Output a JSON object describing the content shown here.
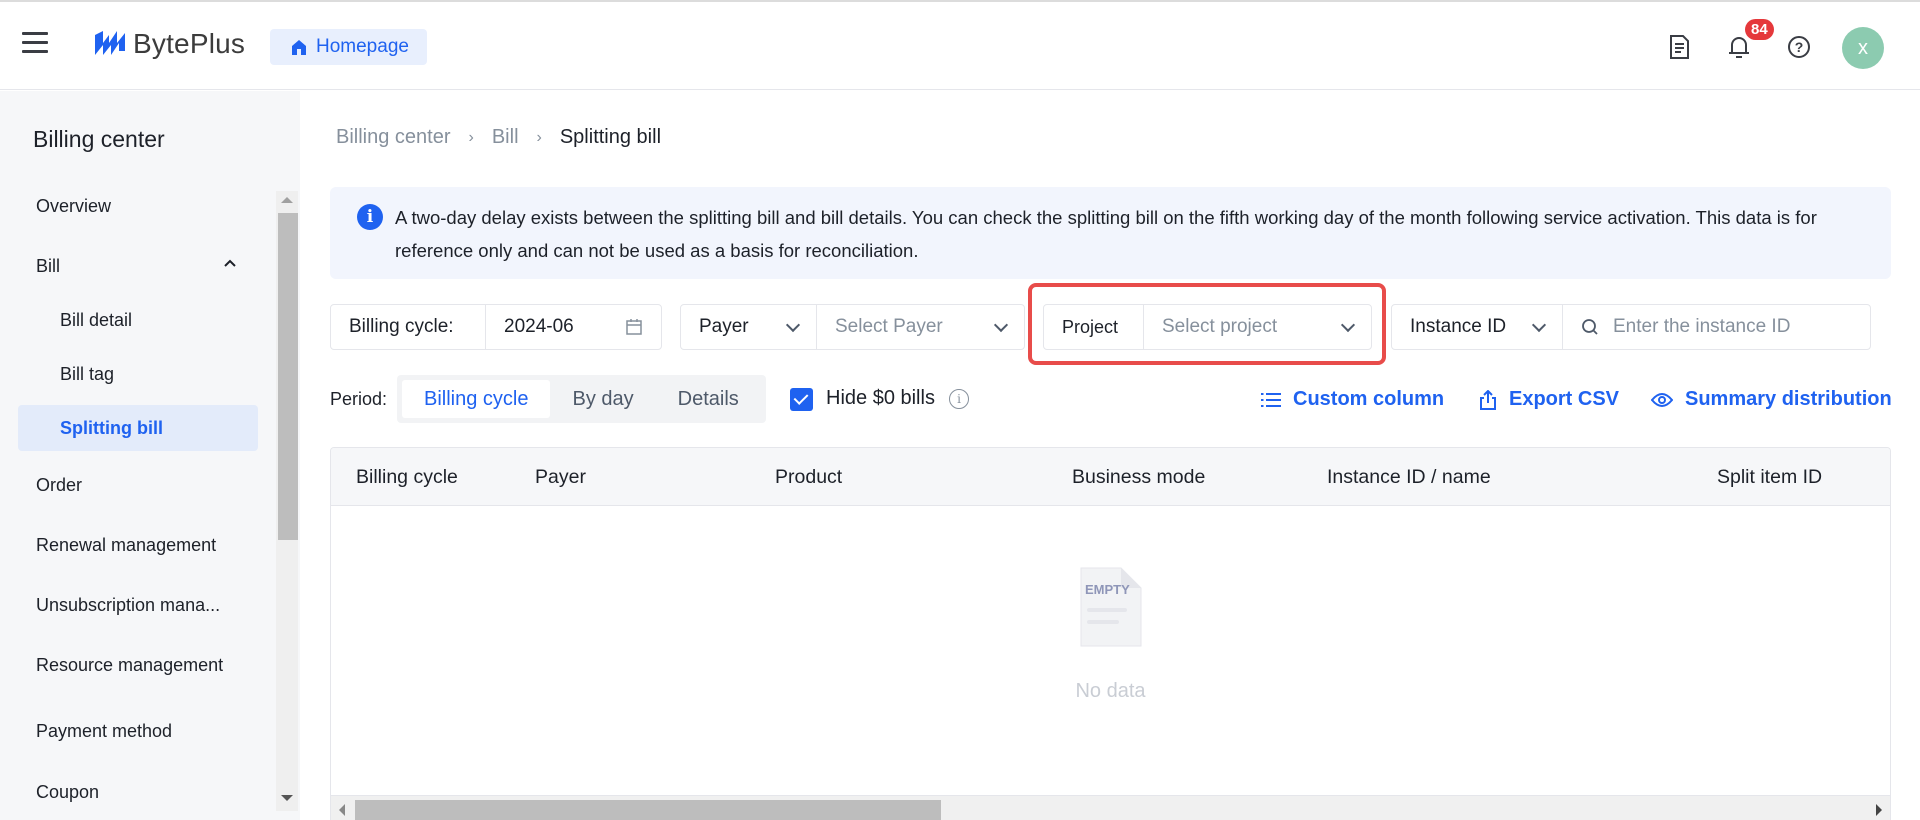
{
  "header": {
    "brand": "BytePlus",
    "home_label": "Homepage",
    "notification_count": "84",
    "avatar_initial": "x",
    "brand_color": "#1f62f0"
  },
  "sidebar": {
    "title": "Billing center",
    "items": [
      {
        "label": "Overview"
      },
      {
        "label": "Bill",
        "expanded": true
      },
      {
        "label": "Bill detail"
      },
      {
        "label": "Bill tag"
      },
      {
        "label": "Splitting bill",
        "active": true
      },
      {
        "label": "Order"
      },
      {
        "label": "Renewal management"
      },
      {
        "label": "Unsubscription mana..."
      },
      {
        "label": "Resource management"
      },
      {
        "label": "Payment method"
      },
      {
        "label": "Coupon"
      }
    ]
  },
  "breadcrumb": {
    "items": [
      "Billing center",
      "Bill"
    ],
    "current": "Splitting bill"
  },
  "alert": {
    "text": "A two-day delay exists between the splitting bill and bill details. You can check the splitting bill on the fifth working day of the month following service activation. This data is for reference only and can not be used as a basis for reconciliation."
  },
  "filters": {
    "billing_cycle_label": "Billing cycle:",
    "billing_cycle_value": "2024-06",
    "payer_type": "Payer",
    "payer_placeholder": "Select Payer",
    "project_label": "Project",
    "project_placeholder": "Select project",
    "instance_type": "Instance ID",
    "instance_placeholder": "Enter the instance ID"
  },
  "period": {
    "label": "Period:",
    "tabs": [
      "Billing cycle",
      "By day",
      "Details"
    ],
    "active_tab": "Billing cycle",
    "hide_zero_label": "Hide $0 bills",
    "hide_zero_checked": true
  },
  "actions": {
    "custom_column": "Custom column",
    "export_csv": "Export CSV",
    "summary_distribution": "Summary distribution"
  },
  "table": {
    "columns": [
      "Billing cycle",
      "Payer",
      "Product",
      "Business mode",
      "Instance ID / name",
      "Split item ID"
    ],
    "empty_icon_text": "EMPTY",
    "empty_text": "No data"
  }
}
